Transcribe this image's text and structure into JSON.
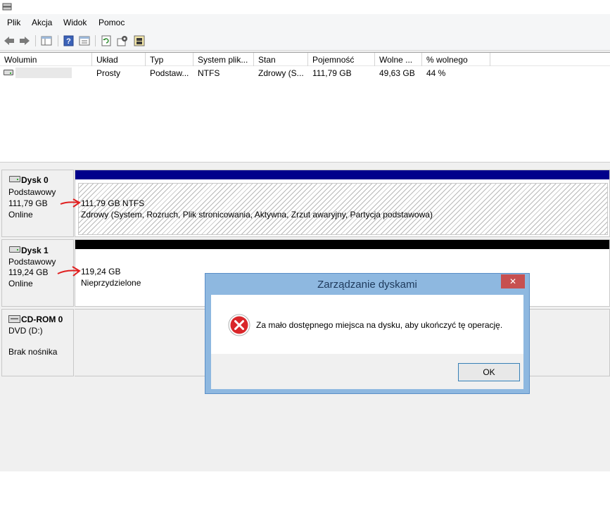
{
  "menubar": {
    "items": [
      "Plik",
      "Akcja",
      "Widok",
      "Pomoc"
    ]
  },
  "toolbar": {
    "icons": [
      "back-icon",
      "forward-icon",
      "show-hide-tree-icon",
      "help-icon",
      "properties-icon",
      "refresh-icon",
      "settings-icon",
      "export-icon"
    ]
  },
  "volume_table": {
    "columns": [
      "Wolumin",
      "Układ",
      "Typ",
      "System plik...",
      "Stan",
      "Pojemność",
      "Wolne ...",
      "% wolnego"
    ],
    "rows": [
      {
        "wolumin": "",
        "uklad": "Prosty",
        "typ": "Podstaw...",
        "system": "NTFS",
        "stan": "Zdrowy (S...",
        "pojemnosc": "111,79 GB",
        "wolne": "49,63 GB",
        "procent": "44 %"
      }
    ]
  },
  "disks": [
    {
      "name": "Dysk 0",
      "type": "Podstawowy",
      "size": "111,79 GB",
      "status": "Online",
      "partition": {
        "line1": "111,79 GB NTFS",
        "line2": "Zdrowy (System, Rozruch, Plik stronicowania, Aktywna, Zrzut awaryjny, Partycja podstawowa)",
        "bar_color": "#00008b"
      }
    },
    {
      "name": "Dysk 1",
      "type": "Podstawowy",
      "size": "119,24 GB",
      "status": "Online",
      "partition": {
        "line1": "119,24 GB",
        "line2": "Nieprzydzielone",
        "bar_color": "#000000"
      }
    },
    {
      "name": "CD-ROM 0",
      "type": "DVD (D:)",
      "status": "Brak nośnika"
    }
  ],
  "dialog": {
    "title": "Zarządzanie dyskami",
    "close": "✕",
    "message": "Za mało dostępnego miejsca na dysku, aby ukończyć tę operację.",
    "ok_label": "OK"
  },
  "colors": {
    "annotation_arrow": "#e02020",
    "error_icon": "#d9262a"
  }
}
